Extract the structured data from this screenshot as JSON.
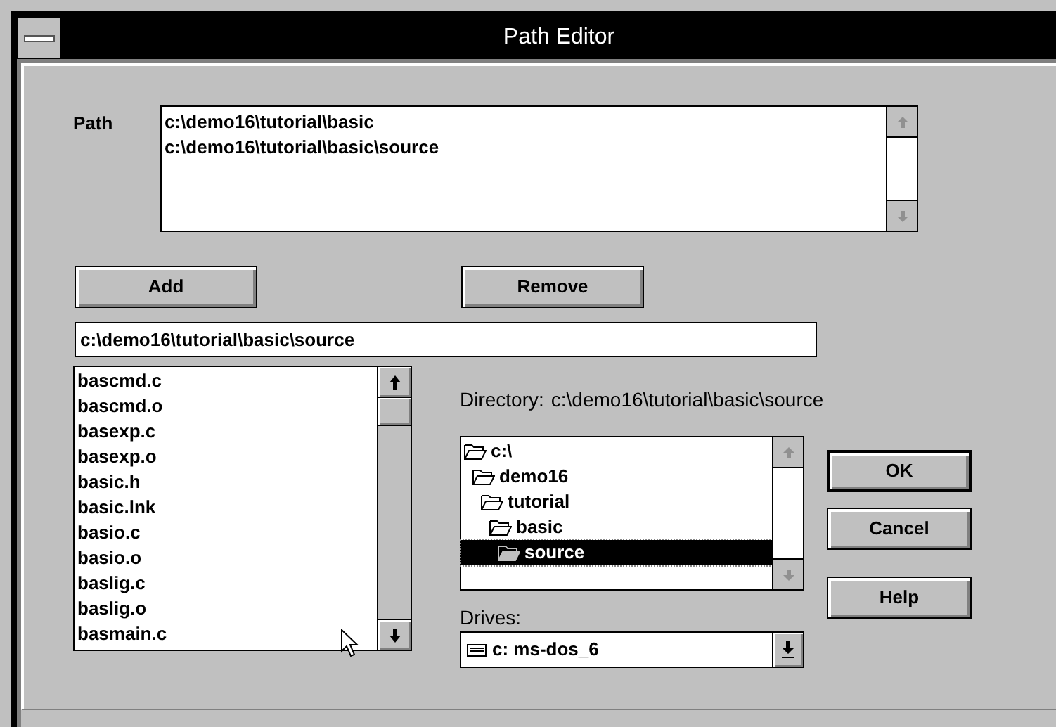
{
  "window": {
    "title": "Path Editor"
  },
  "path": {
    "label": "Path",
    "entries": [
      "c:\\demo16\\tutorial\\basic",
      "c:\\demo16\\tutorial\\basic\\source"
    ]
  },
  "add_button": "Add",
  "remove_button": "Remove",
  "path_field": {
    "value": "c:\\demo16\\tutorial\\basic\\source"
  },
  "files": [
    "bascmd.c",
    "bascmd.o",
    "basexp.c",
    "basexp.o",
    "basic.h",
    "basic.lnk",
    "basio.c",
    "basio.o",
    "baslig.c",
    "baslig.o",
    "basmain.c"
  ],
  "directory": {
    "label": "Directory:",
    "path": "c:\\demo16\\tutorial\\basic\\source",
    "tree": [
      {
        "name": "c:\\",
        "selected": false,
        "children": [
          {
            "name": "demo16",
            "selected": false,
            "children": [
              {
                "name": "tutorial",
                "selected": false,
                "children": [
                  {
                    "name": "basic",
                    "selected": false,
                    "children": [
                      {
                        "name": "source",
                        "selected": true
                      }
                    ]
                  }
                ]
              }
            ]
          }
        ]
      }
    ]
  },
  "drives": {
    "label": "Drives:",
    "value": "c: ms-dos_6"
  },
  "buttons": [
    {
      "label": "OK",
      "default": true
    },
    {
      "label": "Cancel",
      "default": false
    },
    {
      "label": "Help",
      "default": false
    }
  ]
}
